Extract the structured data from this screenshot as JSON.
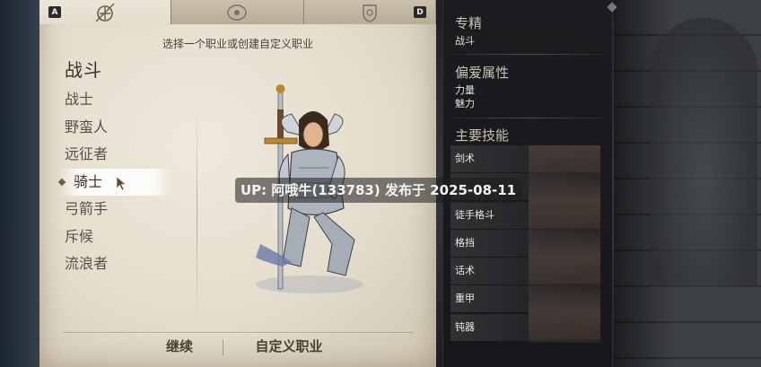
{
  "tabs": [
    {
      "name": "class",
      "active": true
    },
    {
      "name": "background",
      "active": false
    },
    {
      "name": "traits",
      "active": false
    }
  ],
  "keys": {
    "left": "A",
    "right": "D"
  },
  "header": {
    "instruction": "选择一个职业或创建自定义职业"
  },
  "category": {
    "title": "战斗"
  },
  "classes": [
    "战士",
    "野蛮人",
    "远征者",
    "骑士",
    "弓箭手",
    "斥候",
    "流浪者"
  ],
  "selected_class_index": 3,
  "buttons": {
    "continue": "继续",
    "custom": "自定义职业"
  },
  "info": {
    "specialization_title": "专精",
    "specialization_value": "战斗",
    "attributes_title": "偏爱属性",
    "attributes": [
      "力量",
      "魅力"
    ],
    "skills_title": "主要技能",
    "skills": [
      "剑术",
      "",
      "徒手格斗",
      "格挡",
      "话术",
      "重甲",
      "钝器"
    ]
  },
  "overlay": {
    "watermark": "UP: 阿哦牛(133783) 发布于 2025-08-11"
  },
  "colors": {
    "parchment": "#e4ddcd",
    "panel": "#16181b",
    "text_dark": "#3b3128"
  }
}
